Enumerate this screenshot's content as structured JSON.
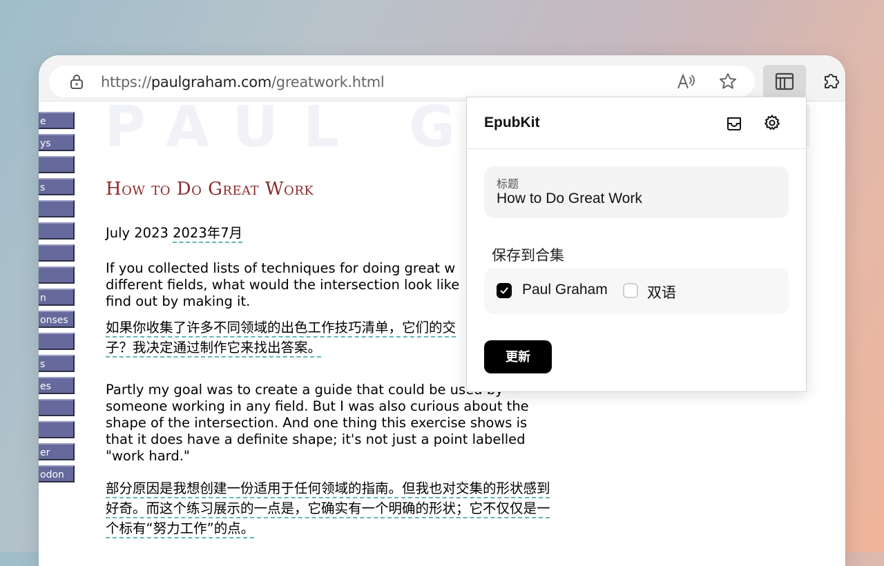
{
  "browser": {
    "url_prefix": "https://",
    "url_domain": "paulgraham.com",
    "url_path": "/greatwork.html"
  },
  "site": {
    "masthead": "PAUL GRAHAM",
    "nav_items": [
      "e",
      "ys",
      "",
      "s",
      "",
      "",
      "",
      "",
      "n",
      "onses",
      "",
      "s",
      "es",
      "",
      "",
      "er",
      "odon"
    ]
  },
  "article": {
    "title": "How to Do Great Work",
    "date_en": "July 2023",
    "date_zh": "2023年7月",
    "p1_en": "If you collected lists of techniques for doing great w\ndifferent fields, what would the intersection look like\nfind out by making it.",
    "p1_zh_line1": "如果你收集了许多不同领域的出色工作技巧清单，它们的交",
    "p1_zh_line2": "子？我决定通过制作它来找出答案。",
    "p2_en": "Partly my goal was to create a guide that could be used by someone working in any field. But I was also curious about the shape of the intersection. And one thing this exercise shows is that it does have a definite shape; it's not just a point labelled \"work hard.\"",
    "p2_zh_line1": "部分原因是我想创建一份适用于任何领域的指南。但我也对交集的形状感到",
    "p2_zh_line2": "好奇。而这个练习展示的一点是，它确实有一个明确的形状；它不仅仅是一",
    "p2_zh_line3": "个标有“努力工作”的点。"
  },
  "popup": {
    "brand": "EpubKit",
    "title_field_label": "标题",
    "title_field_value": "How to Do Great Work",
    "collection_label": "保存到合集",
    "collections": [
      {
        "label": "Paul Graham",
        "checked": true
      },
      {
        "label": "双语",
        "checked": false
      }
    ],
    "update_button": "更新"
  }
}
